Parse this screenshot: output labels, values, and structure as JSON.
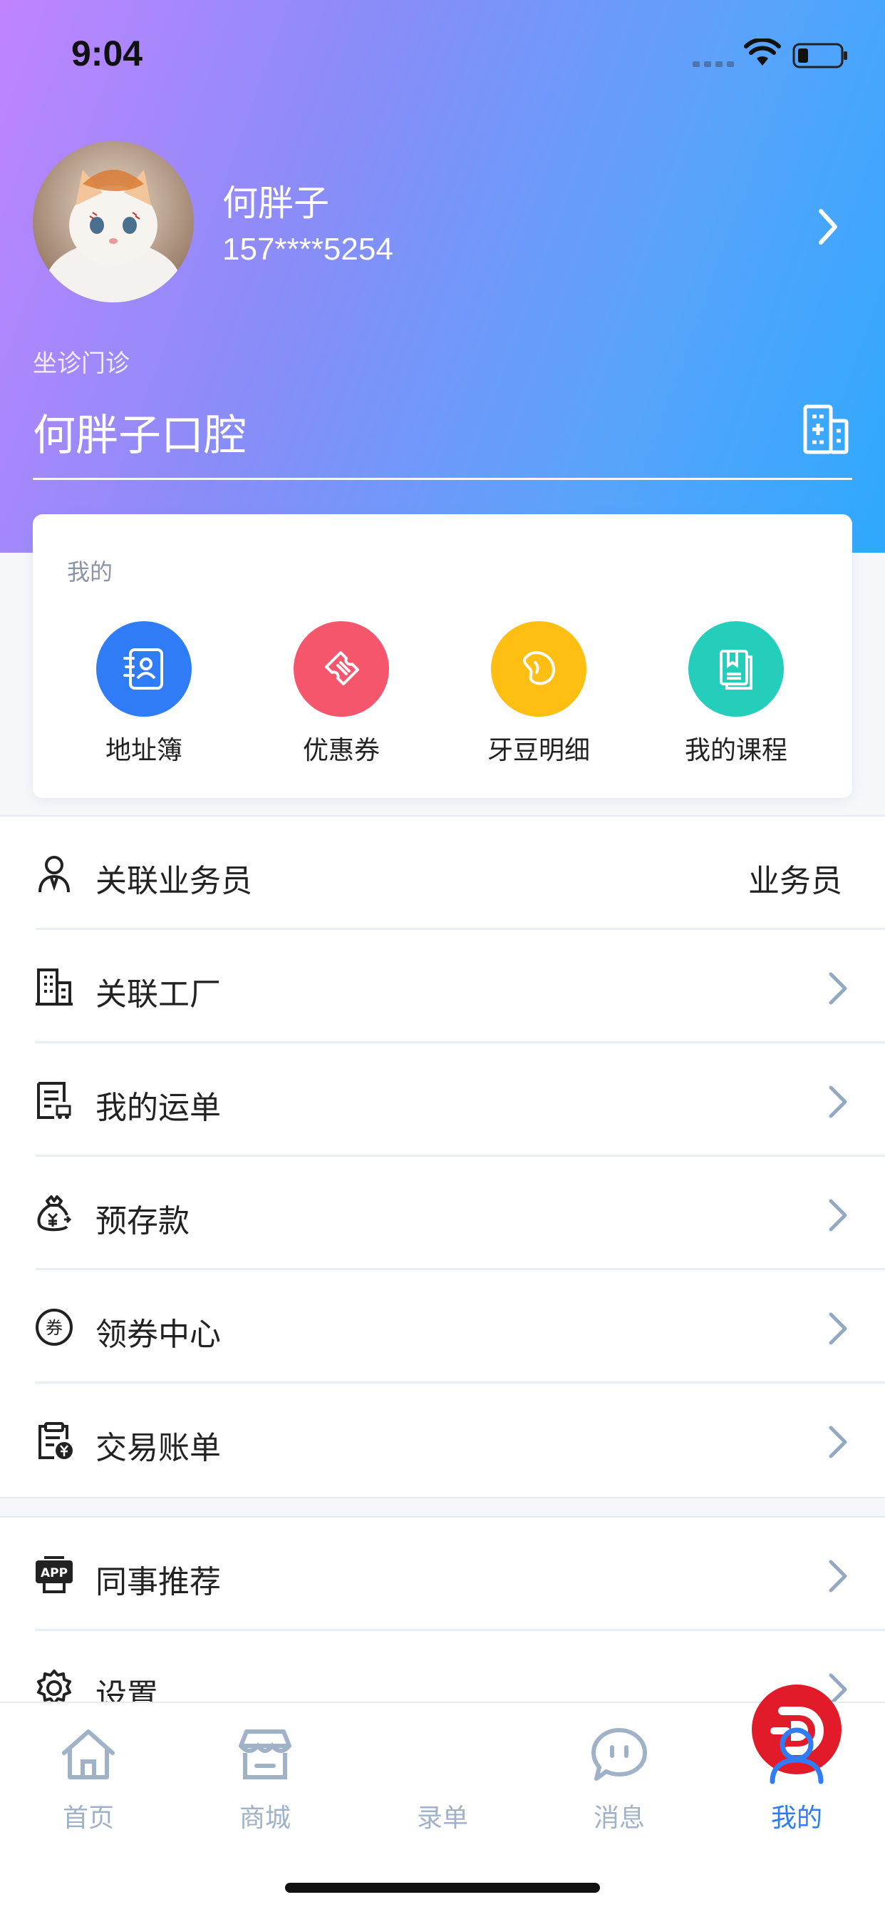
{
  "status_bar": {
    "time": "9:04"
  },
  "profile": {
    "name": "何胖子",
    "phone": "157****5254"
  },
  "clinic": {
    "caption": "坐诊门诊",
    "name": "何胖子口腔"
  },
  "my_card": {
    "title": "我的",
    "shortcuts": [
      {
        "label": "地址簿",
        "icon": "address-book-icon",
        "color": "#2f7cf6"
      },
      {
        "label": "优惠券",
        "icon": "coupon-icon",
        "color": "#f5566c"
      },
      {
        "label": "牙豆明细",
        "icon": "bean-icon",
        "color": "#ffbf12"
      },
      {
        "label": "我的课程",
        "icon": "course-book-icon",
        "color": "#25cdbb"
      }
    ]
  },
  "menu_group_1": [
    {
      "label": "关联业务员",
      "value": "业务员",
      "icon": "salesman-icon"
    },
    {
      "label": "关联工厂",
      "icon": "factory-building-icon"
    },
    {
      "label": "我的运单",
      "icon": "waybill-icon"
    },
    {
      "label": "预存款",
      "icon": "deposit-bag-icon"
    },
    {
      "label": "领券中心",
      "icon": "coupon-center-icon"
    },
    {
      "label": "交易账单",
      "icon": "bill-clipboard-icon"
    }
  ],
  "menu_group_2": [
    {
      "label": "同事推荐",
      "icon": "app-recommend-icon"
    },
    {
      "label": "设置",
      "icon": "settings-gear-icon"
    }
  ],
  "tabbar": {
    "tabs": [
      {
        "label": "首页",
        "icon": "home-icon",
        "active": false
      },
      {
        "label": "商城",
        "icon": "store-icon",
        "active": false
      },
      {
        "label": "录单",
        "icon": "brand-logo-icon",
        "active": false
      },
      {
        "label": "消息",
        "icon": "chat-bubble-icon",
        "active": false
      },
      {
        "label": "我的",
        "icon": "user-icon",
        "active": true
      }
    ]
  },
  "colors": {
    "accent": "#2f7cf6",
    "header_gradient_start": "#c084ff",
    "header_gradient_end": "#2ea9fd",
    "tab_inactive": "#9fb2c8",
    "brand_red": "#e21b2a"
  }
}
